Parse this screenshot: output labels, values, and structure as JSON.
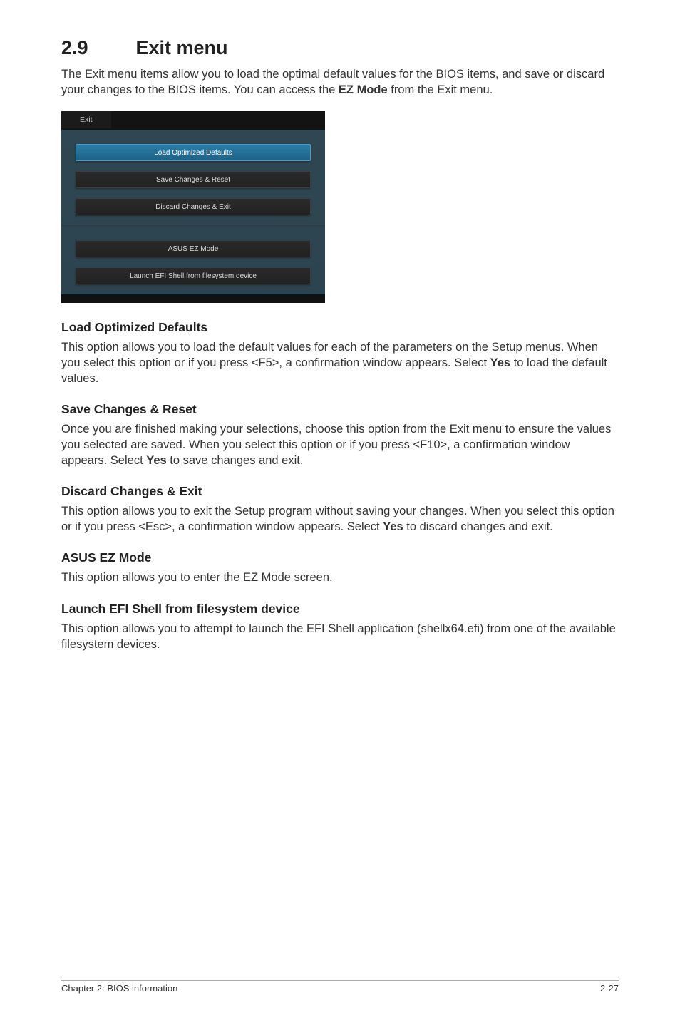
{
  "heading": {
    "number": "2.9",
    "title": "Exit menu"
  },
  "intro_pre": "The Exit menu items allow you to load the optimal default values for the BIOS items, and save or discard your changes to the BIOS items. You can access the ",
  "intro_bold": "EZ Mode",
  "intro_post": " from the Exit menu.",
  "screenshot": {
    "tab": "Exit",
    "buttons": {
      "load_defaults": "Load Optimized Defaults",
      "save_reset": "Save Changes & Reset",
      "discard_exit": "Discard Changes & Exit",
      "ez_mode": "ASUS EZ Mode",
      "launch_efi": "Launch EFI Shell from filesystem device"
    }
  },
  "sections": {
    "load_defaults": {
      "title": "Load Optimized Defaults",
      "p1": "This option allows you to load the default values for each of the parameters on the Setup menus. When you select this option or if you press <F5>, a confirmation window appears. Select ",
      "p1_bold": "Yes",
      "p1_post": " to load the default values."
    },
    "save_reset": {
      "title": "Save Changes & Reset",
      "p1": "Once you are finished making your selections, choose this option from the Exit menu to ensure the values you selected are saved. When you select this option or if you press <F10>, a confirmation window appears. Select ",
      "p1_bold": "Yes",
      "p1_post": " to save changes and exit."
    },
    "discard_exit": {
      "title": "Discard Changes & Exit",
      "p1": "This option allows you to exit the Setup program without saving your changes. When you select this option or if you press <Esc>, a confirmation window appears. Select ",
      "p1_bold": "Yes",
      "p1_post": " to discard changes and exit."
    },
    "ez_mode": {
      "title": "ASUS EZ Mode",
      "p1": "This option allows you to enter the EZ Mode screen."
    },
    "launch_efi": {
      "title": "Launch EFI Shell from filesystem device",
      "p1": "This option allows you to attempt to launch the EFI Shell application (shellx64.efi) from one of the available filesystem devices."
    }
  },
  "footer": {
    "left": "Chapter 2: BIOS information",
    "right": "2-27"
  }
}
